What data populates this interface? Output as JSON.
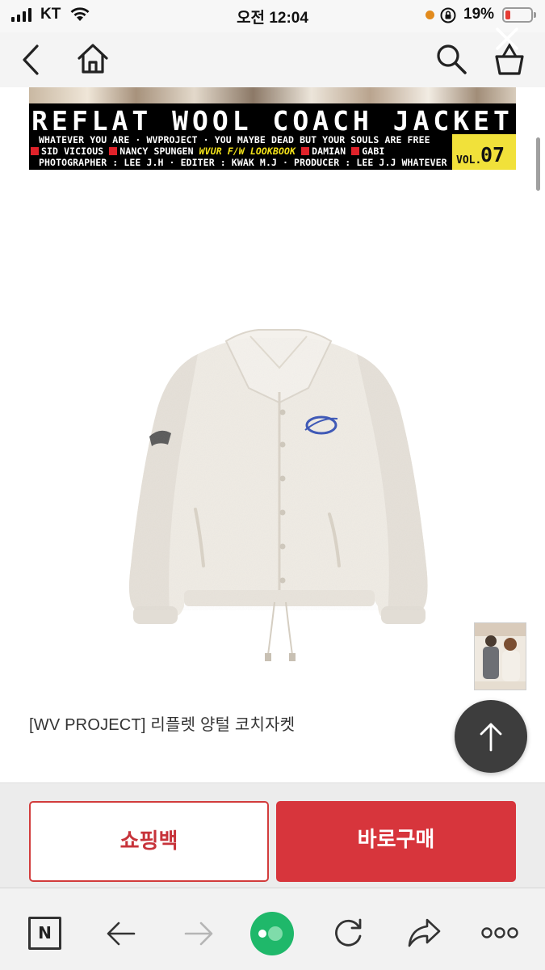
{
  "status_bar": {
    "carrier": "KT",
    "time": "오전 12:04",
    "battery": "19%",
    "battery_color": "#e53c34"
  },
  "header": {
    "icons": [
      "back-icon",
      "home-icon",
      "search-icon",
      "cart-icon",
      "close-icon"
    ]
  },
  "banner": {
    "title": "REFLAT WOOL COACH JACKET",
    "line1": "WHATEVER YOU ARE · WVPROJECT · YOU MAYBE DEAD BUT YOUR SOULS ARE FREE",
    "line2_a": "SID VICIOUS",
    "line2_b": "NANCY SPUNGEN",
    "line2_c": "WVUR F/W LOOKBOOK",
    "line2_d": "DAMIAN",
    "line2_e": "GABI",
    "line3": "PHOTOGRAPHER : LEE J.H · EDITER : KWAK M.J · PRODUCER : LEE J.J  WHATEVER",
    "vol_label": "VOL.",
    "vol_number": "07"
  },
  "product": {
    "name": "[WV PROJECT] 리플렛 양털 코치자켓"
  },
  "actions": {
    "bag_label": "쇼핑백",
    "buy_label": "바로구매",
    "accent_color": "#d7353c"
  },
  "browser_toolbar": {
    "home_letter": "N",
    "icons": [
      "naver-home-icon",
      "back-arrow-icon",
      "forward-arrow-icon",
      "green-dot-icon",
      "refresh-icon",
      "share-icon",
      "more-icon"
    ]
  }
}
